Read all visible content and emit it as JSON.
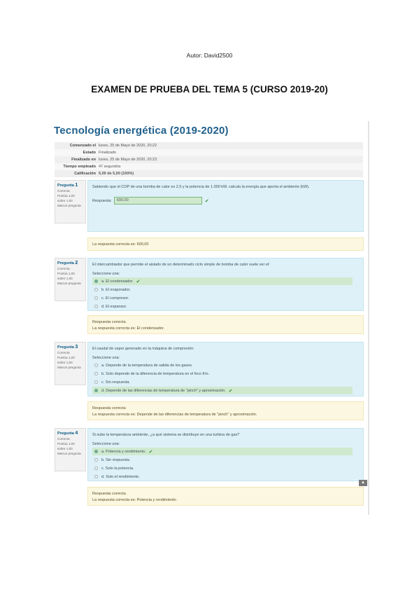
{
  "header": {
    "author": "Autor: David2500",
    "doc_title": "EXAMEN DE PRUEBA DEL TEMA 5 (CURSO 2019-20)"
  },
  "course_title": "Tecnología energética (2019-2020)",
  "summary": [
    {
      "label": "Comenzado el",
      "value": "lunes, 25 de Mayo de 2020, 20:22"
    },
    {
      "label": "Estado",
      "value": "Finalizado"
    },
    {
      "label": "Finalizado en",
      "value": "lunes, 25 de Mayo de 2020, 20:23"
    },
    {
      "label": "Tiempo empleado",
      "value": "47 segundos"
    },
    {
      "label": "Calificación",
      "value": "5,00 de 5,00 (100%)"
    }
  ],
  "questions": [
    {
      "label": "Pregunta",
      "number": "1",
      "status": "Correcta",
      "points": "Puntúa 1,00 sobre 1,00",
      "flag": "Marcar pregunta",
      "text": "Sabiendo que el COP de una bomba de calor es 2,5 y la potencia de 1.000 kW, calcula la energía que aporta el ambiente (kW).",
      "response_label": "Respuesta:",
      "response_value": "600,00",
      "feedback": [
        "La respuesta correcta es: 600,00"
      ]
    },
    {
      "label": "Pregunta",
      "number": "2",
      "status": "Correcta",
      "points": "Puntúa 1,00 sobre 1,00",
      "flag": "Marcar pregunta",
      "text": "El intercambiador que permite el aislado de un determinado ciclo simple de bomba de calor suele ser el:",
      "select_label": "Seleccione una:",
      "choices": [
        "a. El condensador.",
        "b. El evaporador.",
        "c. El compresor.",
        "d. El expansor."
      ],
      "correct_index": 0,
      "feedback": [
        "Respuesta correcta",
        "La respuesta correcta es: El condensador."
      ]
    },
    {
      "label": "Pregunta",
      "number": "3",
      "status": "Correcta",
      "points": "Puntúa 1,00 sobre 1,00",
      "flag": "Marcar pregunta",
      "text": "El caudal de vapor generado en la máquina de compresión:",
      "select_label": "Seleccione una:",
      "choices": [
        "a. Depende de la temperatura de salida de los gases.",
        "b. Solo depende de la diferencia de temperatura en el foco frío.",
        "c. Sin respuesta.",
        "d. Depende de las diferencias de temperatura de \"pinch\" y aproximación."
      ],
      "correct_index": 3,
      "feedback": [
        "Respuesta correcta",
        "La respuesta correcta es: Depende de las diferencias de temperatura de \"pinch\" y aproximación."
      ]
    },
    {
      "label": "Pregunta",
      "number": "4",
      "status": "Correcta",
      "points": "Puntúa 1,00 sobre 1,00",
      "flag": "Marcar pregunta",
      "text": "Si sube la temperatura ambiente, ¿a qué sistema se distribuye en una turbina de gas?",
      "select_label": "Seleccione una:",
      "choices": [
        "a. Potencia y rendimiento.",
        "b. Sin respuesta.",
        "c. Solo la potencia.",
        "d. Solo el rendimiento."
      ],
      "correct_index": 0,
      "feedback": [
        "Respuesta correcta",
        "La respuesta correcta es: Potencia y rendimiento."
      ]
    }
  ],
  "icons": {
    "check": "check-icon",
    "scroll_top": "arrow-up-icon"
  },
  "colors": {
    "title": "#1f5f8b",
    "question_bg": "#def1f8",
    "feedback_bg": "#fcf7e0",
    "correct_bg": "#cfe9cf"
  }
}
